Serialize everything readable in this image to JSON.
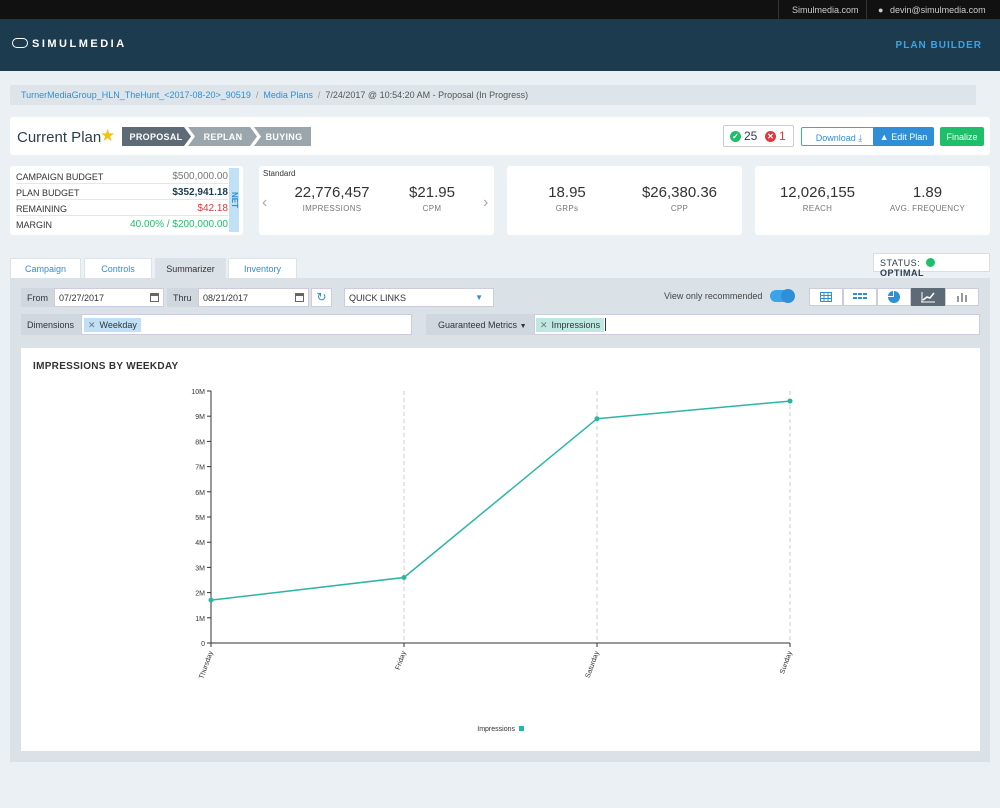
{
  "topbar": {
    "site": "Simulmedia.com",
    "user": "devin@simulmedia.com"
  },
  "header": {
    "logo": "SIMULMEDIA",
    "right_nav": "PLAN BUILDER"
  },
  "breadcrumb": {
    "plan": "TurnerMediaGroup_HLN_TheHunt_<2017-08-20>_90519",
    "media_plans": "Media Plans",
    "current": "7/24/2017 @ 10:54:20 AM - Proposal (In Progress)"
  },
  "plan": {
    "title": "Current Plan",
    "steps": [
      "PROPOSAL",
      "REPLAN",
      "BUYING"
    ],
    "ok_count": "25",
    "error_count": "1",
    "download": "Download",
    "edit": "Edit Plan",
    "finalize": "Finalize"
  },
  "budget": {
    "rows": [
      {
        "label": "CAMPAIGN BUDGET",
        "value": "$500,000.00"
      },
      {
        "label": "PLAN BUDGET",
        "value": "$352,941.18"
      },
      {
        "label": "REMAINING",
        "value": "$42.18"
      },
      {
        "label": "MARGIN",
        "value": "40.00% / $200,000.00"
      }
    ],
    "net": "NET"
  },
  "metrics": {
    "standard": "Standard",
    "impressions": {
      "value": "22,776,457",
      "label": "IMPRESSIONS"
    },
    "cpm": {
      "value": "$21.95",
      "label": "CPM"
    },
    "grps": {
      "value": "18.95",
      "label": "GRPs"
    },
    "cpp": {
      "value": "$26,380.36",
      "label": "CPP"
    },
    "reach": {
      "value": "12,026,155",
      "label": "REACH"
    },
    "frequency": {
      "value": "1.89",
      "label": "AVG. FREQUENCY"
    }
  },
  "tabs": [
    "Campaign",
    "Controls",
    "Summarizer",
    "Inventory"
  ],
  "status": {
    "label": "STATUS:",
    "value": "OPTIMAL",
    "color": "#1fbf6a"
  },
  "filters": {
    "from_label": "From",
    "from_value": "07/27/2017",
    "thru_label": "Thru",
    "thru_value": "08/21/2017",
    "quick_links": "QUICK LINKS",
    "recommended": "View only recommended",
    "dimensions_label": "Dimensions",
    "dimension_chip": "Weekday",
    "metrics_label": "Guaranteed Metrics",
    "metric_chip": "Impressions"
  },
  "colors": {
    "accent": "#2e8fd8",
    "line": "#2bb5a5",
    "green": "#1fbf6a",
    "red": "#e0383e"
  },
  "chart_data": {
    "type": "line",
    "title": "IMPRESSIONS BY WEEKDAY",
    "categories": [
      "Thursday",
      "Friday",
      "Saturday",
      "Sunday"
    ],
    "series": [
      {
        "name": "Impressions",
        "values": [
          1700000,
          2600000,
          8900000,
          9600000
        ]
      }
    ],
    "yticks": [
      "0",
      "1M",
      "2M",
      "3M",
      "4M",
      "5M",
      "6M",
      "7M",
      "8M",
      "9M",
      "10M"
    ],
    "ylim": [
      0,
      10000000
    ],
    "legend": "bottom-center"
  }
}
